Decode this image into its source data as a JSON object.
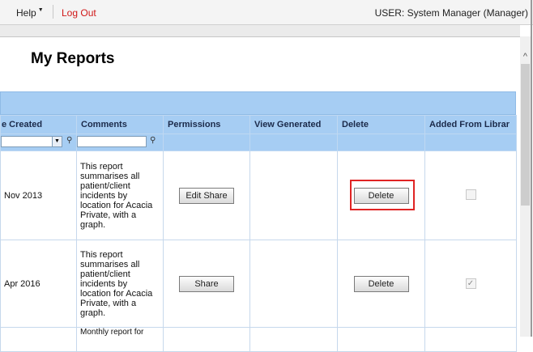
{
  "topbar": {
    "help_label": "Help",
    "logout_label": "Log Out",
    "user_label": "USER: System Manager (Manager)"
  },
  "page": {
    "title": "My Reports"
  },
  "table": {
    "columns": [
      "e Created",
      "Comments",
      "Permissions",
      "View Generated",
      "Delete",
      "Added From Librar"
    ],
    "rows": [
      {
        "date": "Nov 2013",
        "comment": "This report summarises all patient/client incidents by location for Acacia Private, with a graph.",
        "permission_button": "Edit Share",
        "delete_button": "Delete",
        "added_from_library": false
      },
      {
        "date": "Apr 2016",
        "comment": "This report summarises all patient/client incidents by location for Acacia Private, with a graph.",
        "permission_button": "Share",
        "delete_button": "Delete",
        "added_from_library": true
      },
      {
        "comment_partial": "Monthly report for"
      }
    ]
  },
  "icons": {
    "filter": "filter-icon",
    "dropdown": "chevron-down-icon",
    "scroll_up": "chevron-up-icon"
  },
  "colors": {
    "header_bg": "#a6cdf3",
    "logout": "#d01818",
    "highlight": "#e02424"
  }
}
